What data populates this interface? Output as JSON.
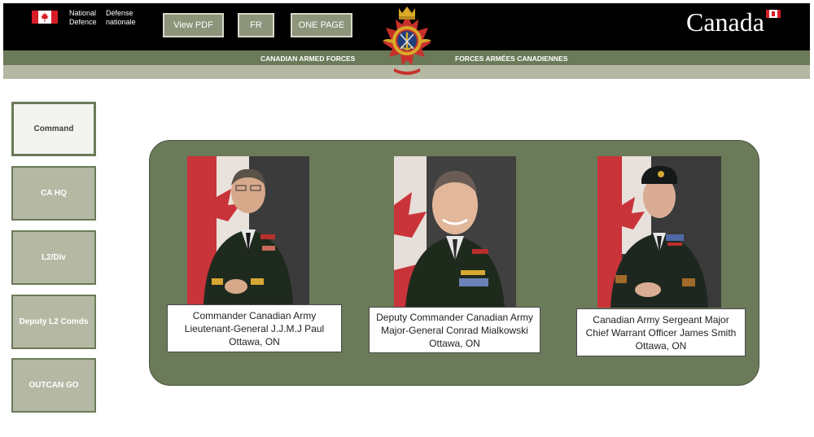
{
  "header": {
    "dept_en_line1": "National",
    "dept_en_line2": "Defence",
    "dept_fr_line1": "Défense",
    "dept_fr_line2": "nationale",
    "buttons": {
      "view_pdf": "View PDF",
      "fr": "FR",
      "one_page": "ONE PAGE"
    },
    "canada_wordmark": "Canada",
    "band_en": "CANADIAN ARMED FORCES",
    "band_fr": "FORCES ARMÉES CANADIENNES"
  },
  "sidebar": {
    "items": [
      {
        "label": "Command",
        "active": true
      },
      {
        "label": "CA HQ",
        "active": false
      },
      {
        "label": "L2/Div",
        "active": false
      },
      {
        "label": "Deputy L2 Comds",
        "active": false
      },
      {
        "label": "OUTCAN GO",
        "active": false
      }
    ]
  },
  "leaders": [
    {
      "title": "Commander Canadian Army",
      "name": "Lieutenant-General J.J.M.J Paul",
      "location": "Ottawa, ON"
    },
    {
      "title": "Deputy Commander Canadian Army",
      "name": "Major-General Conrad Mialkowski",
      "location": "Ottawa, ON"
    },
    {
      "title": "Canadian Army Sergeant Major",
      "name": "Chief Warrant Officer James Smith",
      "location": "Ottawa, ON"
    }
  ],
  "colors": {
    "header_black": "#000000",
    "header_green": "#6b7a58",
    "header_band": "#b5b9a3",
    "panel_green": "#6b7a58",
    "flag_red": "#d71e28"
  }
}
